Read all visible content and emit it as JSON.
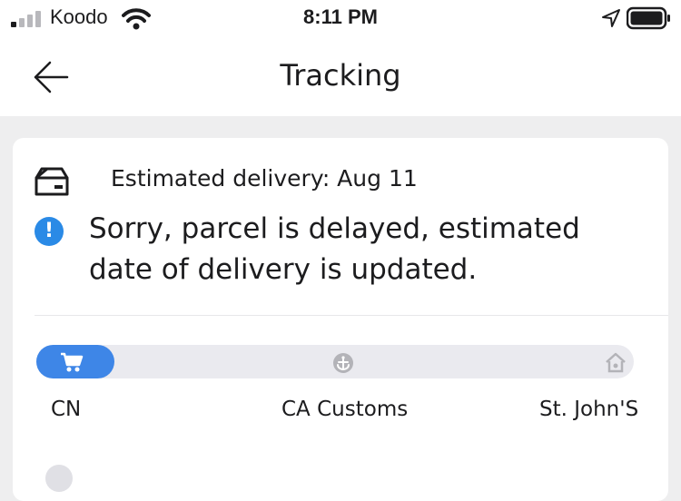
{
  "status_bar": {
    "carrier": "Koodo",
    "time": "8:11 PM"
  },
  "header": {
    "title": "Tracking"
  },
  "card": {
    "estimated_delivery": "Estimated delivery: Aug 11",
    "delay_message": "Sorry, parcel is delayed, estimated date of delivery is updated.",
    "progress": {
      "fraction": 0.13,
      "stops": [
        {
          "label": "CN",
          "icon": "cart-icon"
        },
        {
          "label": "CA Customs",
          "icon": "anchor-icon"
        },
        {
          "label": "St. John'S",
          "icon": "home-icon"
        }
      ]
    }
  },
  "colors": {
    "accent": "#3e86e7",
    "info": "#2a8ae6",
    "track": "#eaeaef",
    "background": "#eeeeef"
  }
}
